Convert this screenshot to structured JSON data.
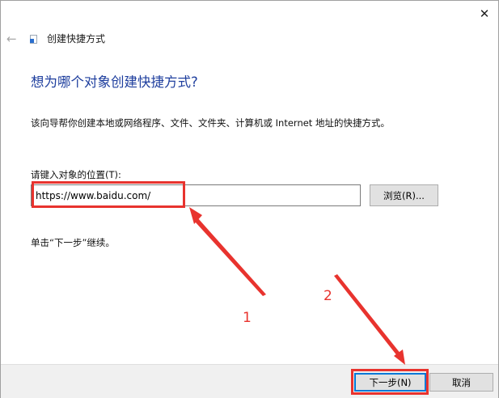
{
  "window": {
    "title": "创建快捷方式",
    "close_glyph": "✕",
    "back_glyph": "←"
  },
  "heading": "想为哪个对象创建快捷方式?",
  "description": "该向导帮你创建本地或网络程序、文件、文件夹、计算机或 Internet 地址的快捷方式。",
  "location": {
    "label": "请键入对象的位置(T):",
    "value": "https://www.baidu.com/",
    "browse_label": "浏览(R)..."
  },
  "hint": "单击“下一步”继续。",
  "buttons": {
    "next_label": "下一步(N)",
    "cancel_label": "取消"
  },
  "annotations": {
    "label_1": "1",
    "label_2": "2",
    "color": "#e8332e"
  },
  "accent_color": "#0078d7",
  "heading_color": "#1f3f9e"
}
